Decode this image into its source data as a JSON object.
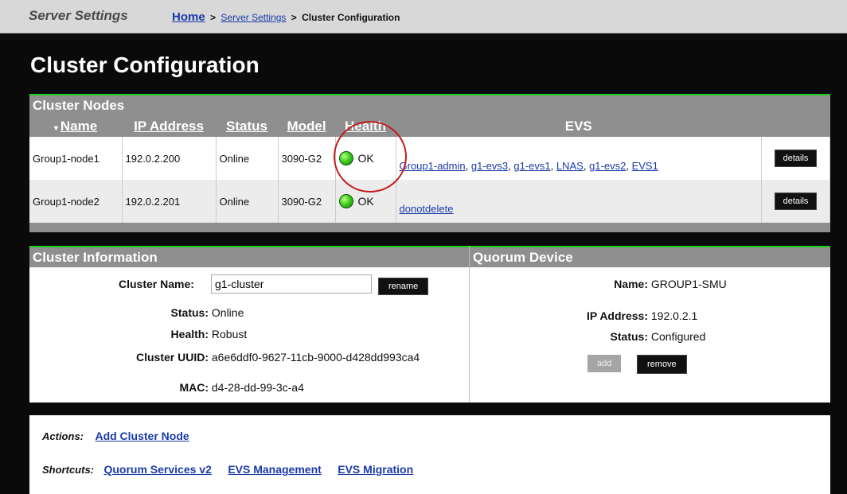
{
  "topbar": {
    "section_title": "Server Settings",
    "breadcrumb": {
      "home": "Home",
      "sep1": ">",
      "server_settings": "Server Settings",
      "sep2": ">",
      "current": "Cluster Configuration"
    }
  },
  "page_title": "Cluster Configuration",
  "nodes_panel": {
    "title": "Cluster Nodes",
    "sort_indicator": "▾",
    "columns": [
      "Name",
      "IP Address",
      "Status",
      "Model",
      "Health",
      "EVS",
      ""
    ],
    "rows": [
      {
        "name": "Group1-node1",
        "ip": "192.0.2.200",
        "status": "Online",
        "model": "3090-G2",
        "health": "OK",
        "evs": [
          "Group1-admin",
          "g1-evs3",
          "g1-evs1",
          "LNAS",
          "g1-evs2",
          "EVS1"
        ],
        "evs_sep": ",",
        "details": "details"
      },
      {
        "name": "Group1-node2",
        "ip": "192.0.2.201",
        "status": "Online",
        "model": "3090-G2",
        "health": "OK",
        "evs": [
          "donotdelete"
        ],
        "details": "details"
      }
    ],
    "health_color": "#3fcf1f",
    "highlight_color": "#c41e1e"
  },
  "cluster_info": {
    "title": "Cluster Information",
    "cluster_name_label": "Cluster Name:",
    "cluster_name_value": "g1-cluster",
    "rename": "rename",
    "status_label": "Status:",
    "status_value": "Online",
    "health_label": "Health:",
    "health_value": "Robust",
    "uuid_label": "Cluster UUID:",
    "uuid_value": "a6e6ddf0-9627-11cb-9000-d428dd993ca4",
    "mac_label": "MAC:",
    "mac_value": "d4-28-dd-99-3c-a4"
  },
  "quorum": {
    "title": "Quorum Device",
    "name_label": "Name:",
    "name_value": "GROUP1-SMU",
    "ip_label": "IP Address:",
    "ip_value": "192.0.2.1",
    "status_label": "Status:",
    "status_value": "Configured",
    "add": "add",
    "remove": "remove"
  },
  "actions": {
    "actions_label": "Actions:",
    "add_node": "Add Cluster Node",
    "shortcuts_label": "Shortcuts:",
    "shortcuts": [
      "Quorum Services v2",
      "EVS Management",
      "EVS Migration"
    ]
  },
  "colors": {
    "panel_header": "#8f8f8f",
    "panel_accent": "#1fcc1f",
    "link": "#1a3aa8",
    "background": "#0a0a0a"
  }
}
